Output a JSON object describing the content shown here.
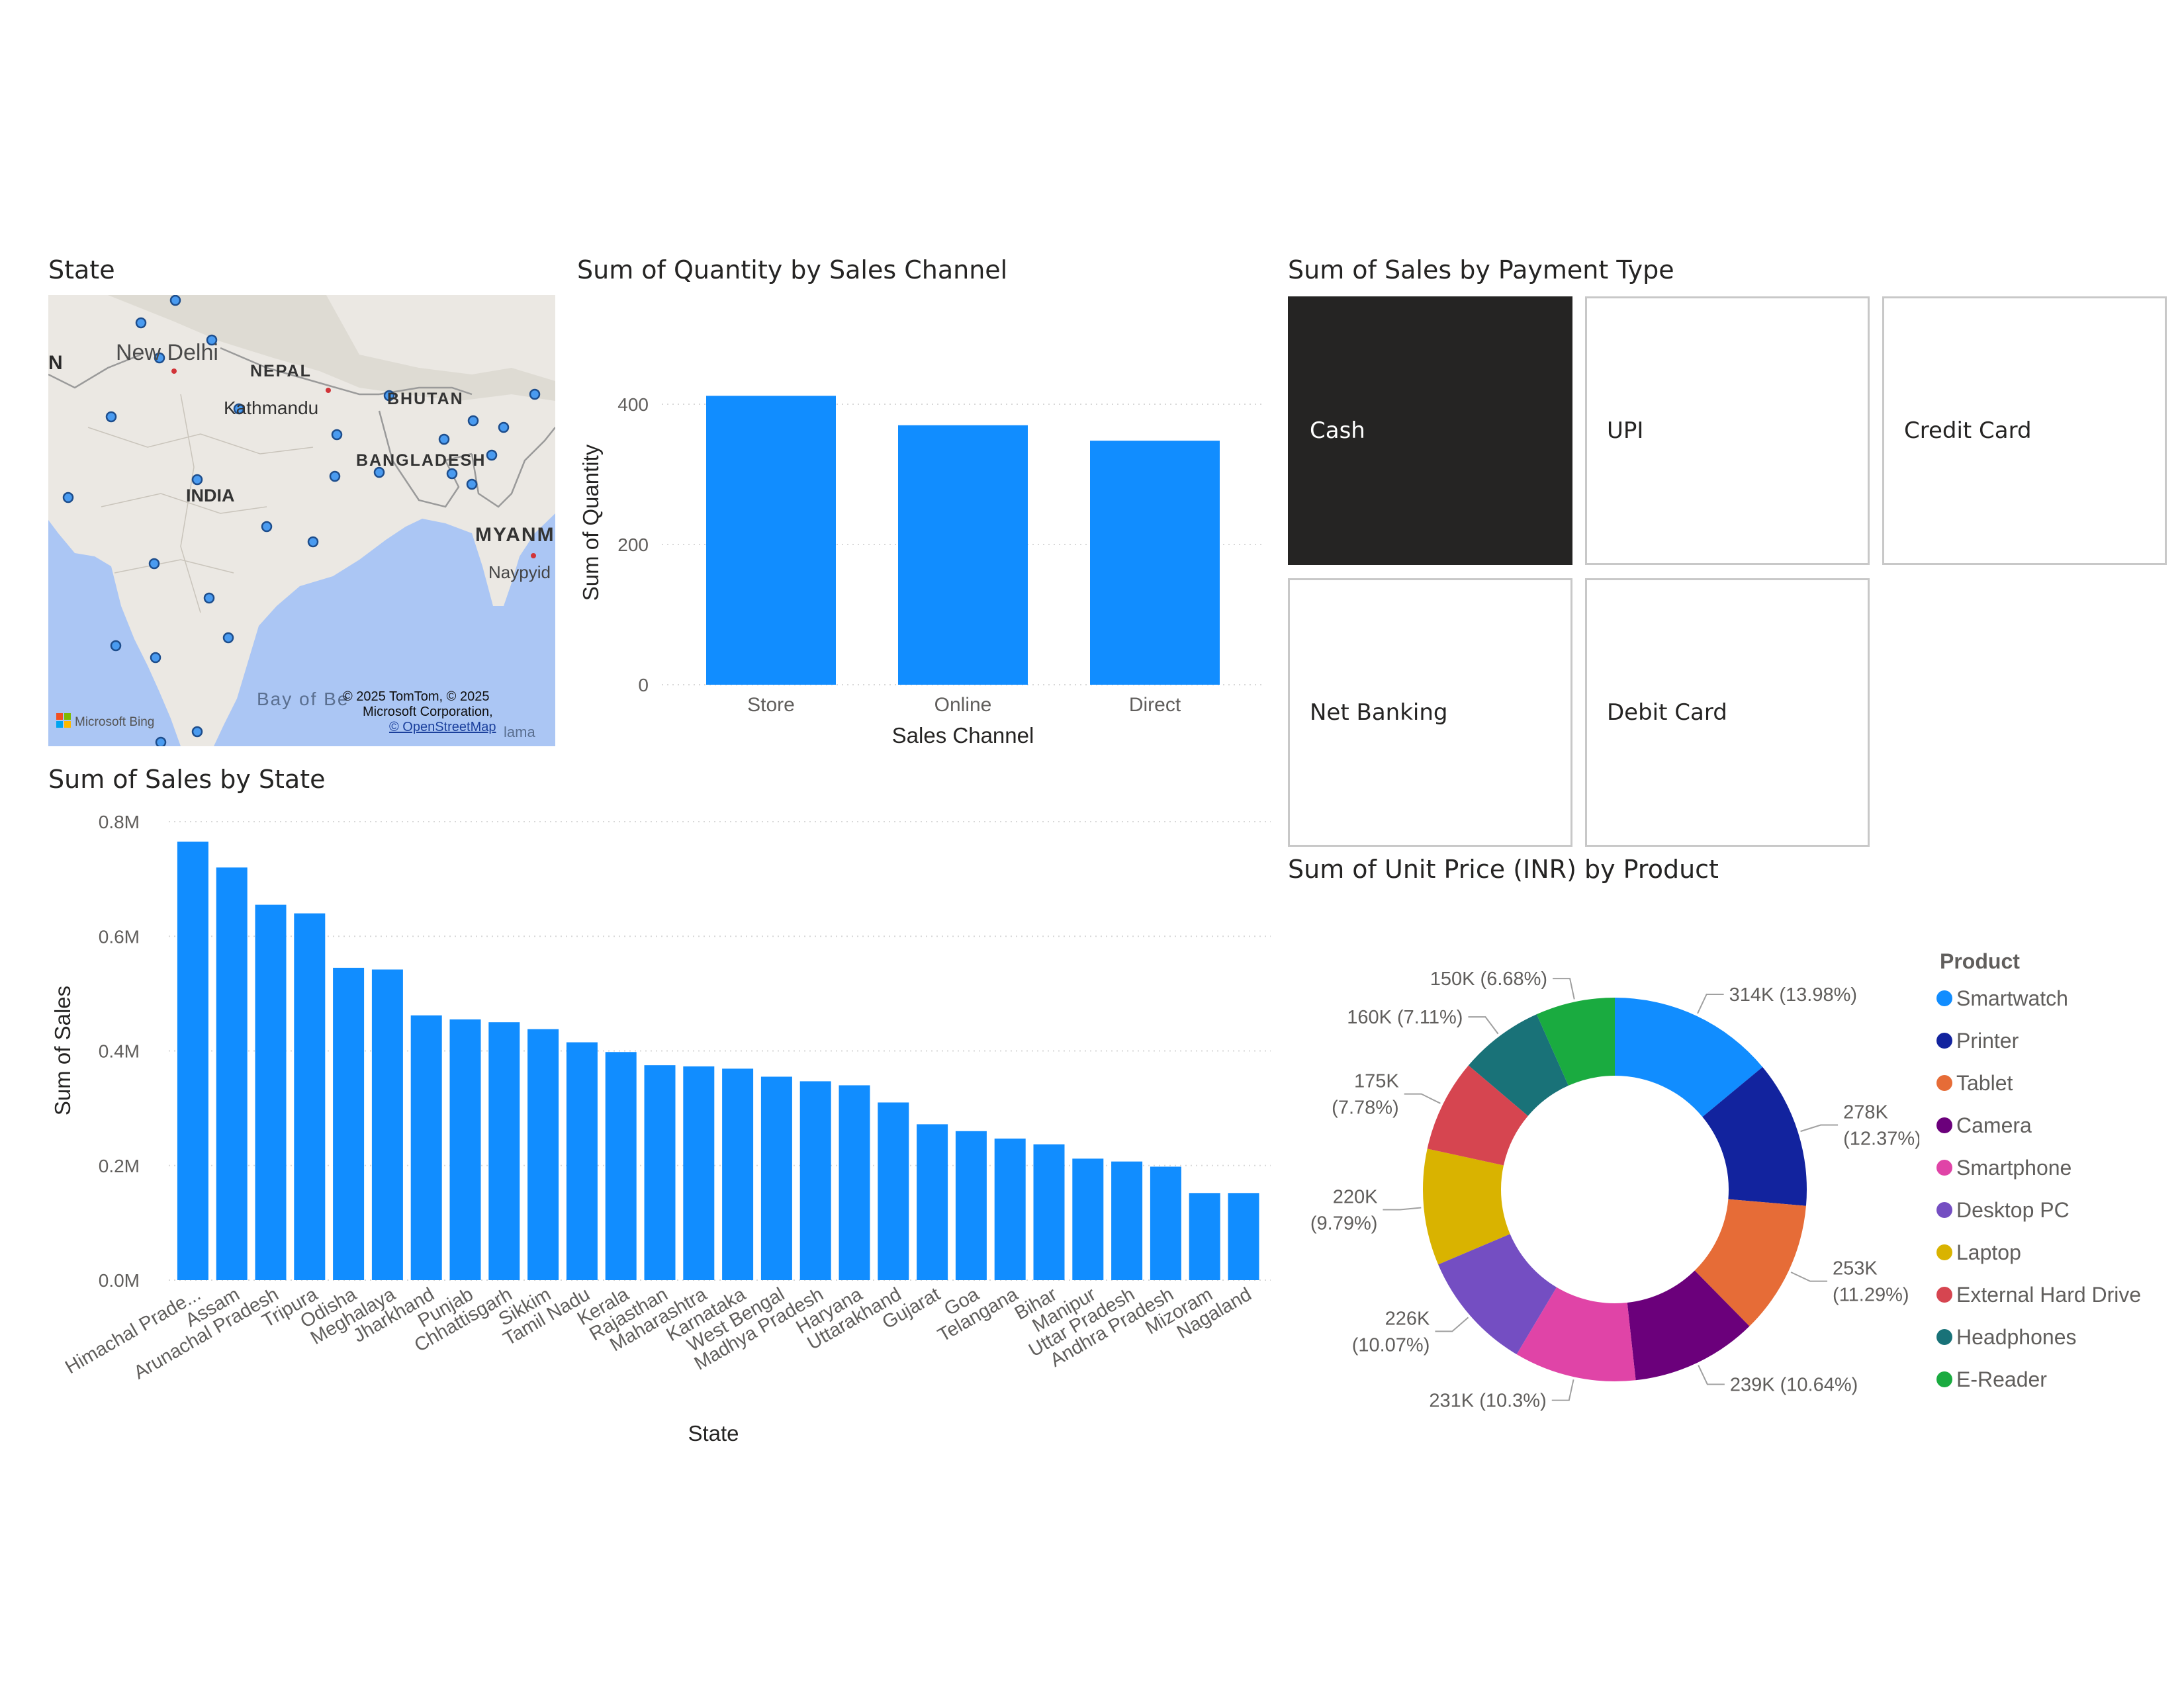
{
  "map": {
    "title": "State",
    "labels": {
      "new_delhi": "New Delhi",
      "nepal": "NEPAL",
      "kathmandu": "Kathmandu",
      "bhutan": "BHUTAN",
      "bangladesh": "BANGLADESH",
      "india": "INDIA",
      "myanmar": "MYANM",
      "naypyidaw": "Naypyid",
      "bay": "Bay of Be",
      "copyright1": "© 2025 TomTom, © 2025",
      "copyright2": "Microsoft Corporation,",
      "copyright3": "© OpenStreetMap",
      "bing": "Microsoft Bing",
      "left_edge": "N",
      "bottom_edge": "lama"
    },
    "colors": {
      "water": "#abc6f4",
      "land": "#ebe8e3",
      "dot": "#3c8ee8"
    }
  },
  "quantity_chart": {
    "title": "Sum of Quantity by Sales Channel",
    "chart_data": {
      "type": "bar",
      "categories": [
        "Store",
        "Online",
        "Direct"
      ],
      "values": [
        412,
        370,
        348
      ],
      "xlabel": "Sales Channel",
      "ylabel": "Sum of Quantity",
      "ylim": [
        0,
        450
      ],
      "yticks": [
        "0",
        "200",
        "400"
      ],
      "grid": true,
      "color": "#118dff"
    }
  },
  "state_chart": {
    "title": "Sum of Sales by State",
    "chart_data": {
      "type": "bar",
      "categories": [
        "Himachal Prade...",
        "Assam",
        "Arunachal Pradesh",
        "Tripura",
        "Odisha",
        "Meghalaya",
        "Jharkhand",
        "Punjab",
        "Chhattisgarh",
        "Sikkim",
        "Tamil Nadu",
        "Kerala",
        "Rajasthan",
        "Maharashtra",
        "Karnataka",
        "West Bengal",
        "Madhya Pradesh",
        "Haryana",
        "Uttarakhand",
        "Gujarat",
        "Goa",
        "Telangana",
        "Bihar",
        "Manipur",
        "Uttar Pradesh",
        "Andhra Pradesh",
        "Mizoram",
        "Nagaland"
      ],
      "values": [
        765000,
        720000,
        655000,
        640000,
        545000,
        542000,
        462000,
        455000,
        450000,
        438000,
        415000,
        398000,
        375000,
        373000,
        369000,
        355000,
        347000,
        340000,
        310000,
        272000,
        260000,
        247000,
        237000,
        212000,
        207000,
        198000,
        152000,
        152000
      ],
      "xlabel": "State",
      "ylabel": "Sum of Sales",
      "ylim": [
        0,
        800000
      ],
      "yticks": [
        "0.0M",
        "0.2M",
        "0.4M",
        "0.6M",
        "0.8M"
      ],
      "grid": true,
      "color": "#118dff"
    }
  },
  "payment_slicer": {
    "title": "Sum of Sales by Payment Type",
    "tiles": [
      "Cash",
      "UPI",
      "Credit Card",
      "Net Banking",
      "Debit Card"
    ],
    "selected": "Cash"
  },
  "product_chart": {
    "title": "Sum of Unit Price (INR) by Product",
    "legend_title": "Product",
    "chart_data": {
      "type": "pie",
      "donut": true,
      "labels": [
        "Smartwatch",
        "Printer",
        "Tablet",
        "Camera",
        "Smartphone",
        "Desktop PC",
        "Laptop",
        "External Hard Drive",
        "Headphones",
        "E-Reader"
      ],
      "values": [
        314,
        278,
        253,
        239,
        231,
        226,
        220,
        175,
        160,
        150
      ],
      "colors": [
        "#118dff",
        "#12239e",
        "#e66c37",
        "#6b007b",
        "#e044a7",
        "#744ec2",
        "#d9b300",
        "#d64550",
        "#197278",
        "#1aab40"
      ],
      "data_labels": [
        [
          "314K (13.98%)"
        ],
        [
          "278K",
          "(12.37%)"
        ],
        [
          "253K",
          "(11.29%)"
        ],
        [
          "239K (10.64%)"
        ],
        [
          "231K (10.3%)"
        ],
        [
          "226K",
          "(10.07%)"
        ],
        [
          "220K",
          "(9.79%)"
        ],
        [
          "175K",
          "(7.78%)"
        ],
        [
          "160K (7.11%)"
        ],
        [
          "150K (6.68%)"
        ]
      ],
      "legend_position": "right"
    }
  }
}
